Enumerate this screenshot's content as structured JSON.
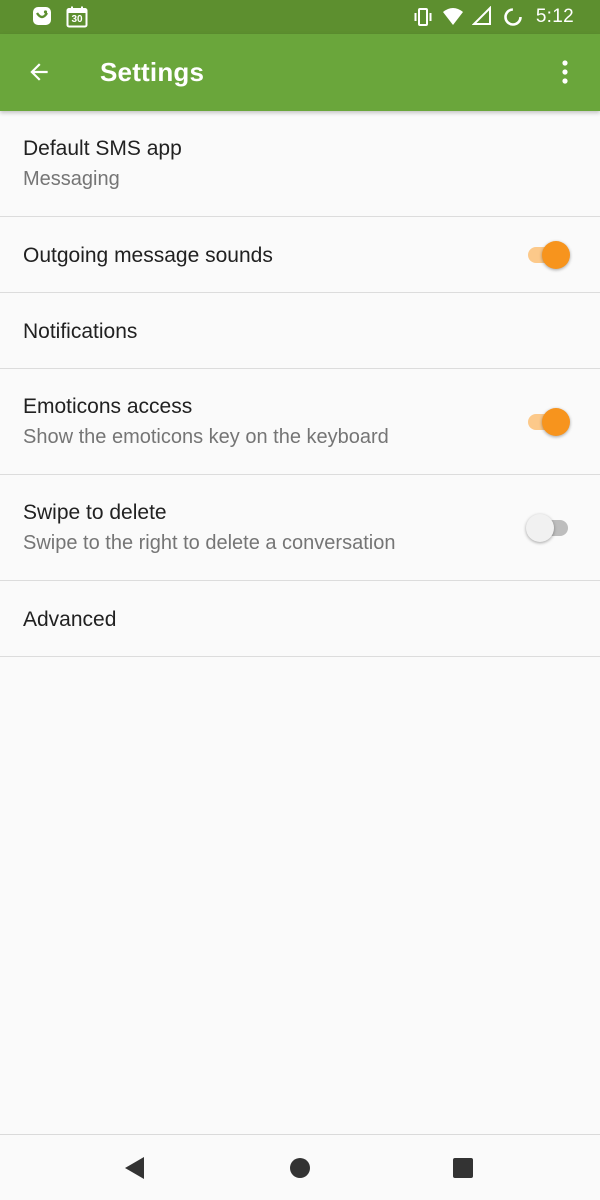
{
  "status_bar": {
    "time": "5:12",
    "calendar_day": "30",
    "icons": [
      "notification-app-icon",
      "calendar-icon",
      "vibrate-icon",
      "wifi-icon",
      "signal-icon",
      "battery-icon"
    ]
  },
  "app_bar": {
    "title": "Settings",
    "back_icon": "arrow-back-icon",
    "overflow_icon": "more-vert-icon",
    "color": "#6aa63b",
    "status_color": "#5d8f2f"
  },
  "settings": [
    {
      "title": "Default SMS app",
      "subtitle": "Messaging"
    },
    {
      "title": "Outgoing message sounds",
      "switch": true
    },
    {
      "title": "Notifications"
    },
    {
      "title": "Emoticons access",
      "subtitle": "Show the emoticons key on the keyboard",
      "switch": true
    },
    {
      "title": "Swipe to delete",
      "subtitle": "Swipe to the right to delete a conversation",
      "switch": false
    },
    {
      "title": "Advanced"
    }
  ],
  "accent_color": "#f7941d",
  "nav_bar": {
    "icons": [
      "nav-back-icon",
      "nav-home-icon",
      "nav-recents-icon"
    ]
  }
}
